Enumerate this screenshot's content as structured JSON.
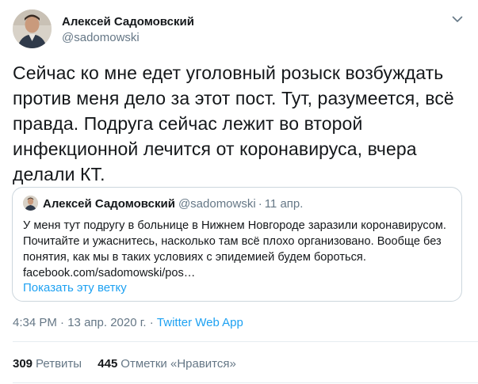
{
  "author": {
    "display_name": "Алексей Садомовский",
    "handle": "@sadomowski"
  },
  "tweet": {
    "text": "Сейчас ко мне едет уголовный розыск возбуждать против меня дело за этот пост. Тут, разумеется, всё правда. Подруга сейчас лежит во второй инфекционной лечится от коронавируса, вчера делали КТ."
  },
  "quoted_tweet": {
    "display_name": "Алексей Садомовский",
    "handle": "@sadomowski",
    "separator": "·",
    "date": "11 апр.",
    "text": "У меня тут подругу в больнице в Нижнем Новгороде заразили коронавирусом. Почитайте и ужаснитесь, насколько там всё плохо организовано. Вообще без понятия, как мы в таких условиях с эпидемией будем бороться. facebook.com/sadomowski/pos…",
    "show_thread": "Показать эту ветку"
  },
  "meta": {
    "time": "4:34 PM",
    "date": "13 апр. 2020 г.",
    "separator": "·",
    "source": "Twitter Web App"
  },
  "stats": {
    "retweets_count": "309",
    "retweets_label": "Ретвиты",
    "likes_count": "445",
    "likes_label": "Отметки «Нравится»"
  },
  "icons": {
    "menu": "chevron-down-icon"
  },
  "colors": {
    "link": "#1da1f2",
    "secondary_text": "#657786",
    "border": "#ccd6dd"
  }
}
